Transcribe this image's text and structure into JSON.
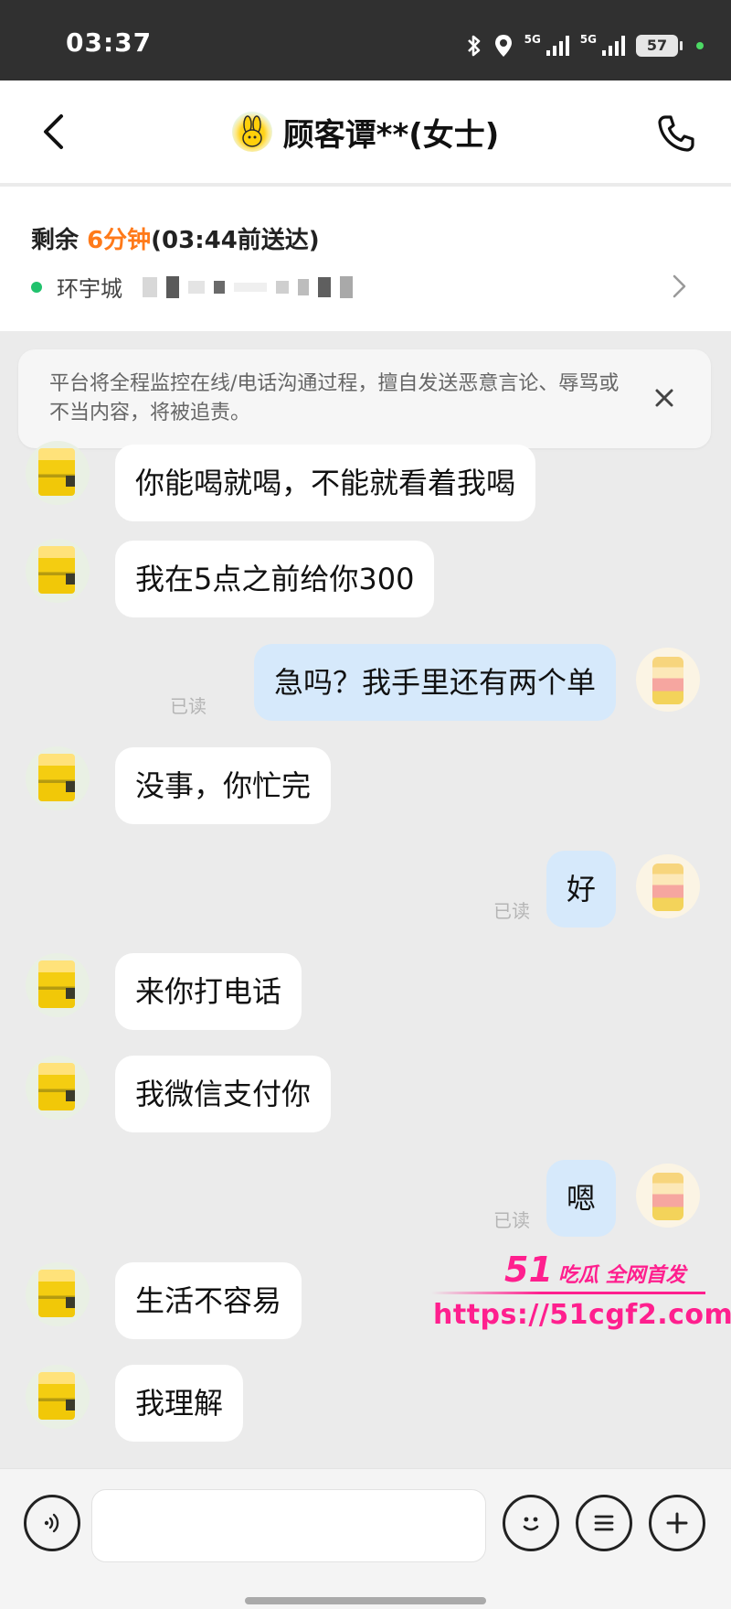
{
  "status_bar": {
    "time": "03:37",
    "network_1": "5G",
    "network_2": "5G",
    "battery": "57",
    "icons": [
      "bluetooth-icon",
      "location-icon",
      "signal-icon",
      "signal-icon",
      "battery-icon"
    ]
  },
  "header": {
    "title": "顾客谭**(女士)",
    "back_icon": "chevron-left-icon",
    "call_icon": "phone-icon"
  },
  "order": {
    "prefix": "剩余 ",
    "remaining": "6分钟",
    "deadline": "(03:44前送达)",
    "address_visible": "环宇城",
    "status_color": "#21c26d",
    "highlight_color": "#ff7a1a"
  },
  "notice": {
    "text": "平台将全程监控在线/电话沟通过程，擅自发送恶意言论、辱骂或不当内容，将被追责。"
  },
  "messages": [
    {
      "side": "left",
      "text": "你能喝就喝，不能就看着我喝"
    },
    {
      "side": "left",
      "text": "我在5点之前给你300"
    },
    {
      "side": "right",
      "text": "急吗？我手里还有两个单",
      "status": "已读"
    },
    {
      "side": "left",
      "text": "没事，你忙完"
    },
    {
      "side": "right",
      "text": "好",
      "status": "已读"
    },
    {
      "side": "left",
      "text": "来你打电话"
    },
    {
      "side": "left",
      "text": "我微信支付你"
    },
    {
      "side": "right",
      "text": "嗯",
      "status": "已读"
    },
    {
      "side": "left",
      "text": "生活不容易"
    },
    {
      "side": "left",
      "text": "我理解"
    }
  ],
  "watermark": {
    "line1_num": "51",
    "line1_text": "吃瓜 全网首发",
    "line2": "https://51cgf2.com",
    "color": "#ff1f8e"
  },
  "input_bar": {
    "placeholder": "",
    "voice_icon": "voice-icon",
    "emoji_icon": "emoji-icon",
    "menu_icon": "list-icon",
    "add_icon": "plus-icon"
  },
  "colors": {
    "bubble_left": "#ffffff",
    "bubble_right": "#d6e9fb",
    "background": "#ebebeb"
  }
}
